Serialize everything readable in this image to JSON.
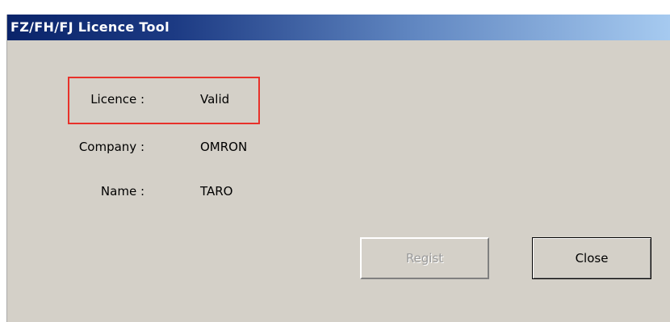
{
  "window": {
    "title": "FZ/FH/FJ Licence Tool"
  },
  "fields": {
    "licence": {
      "label": "Licence :",
      "value": "Valid"
    },
    "company": {
      "label": "Company :",
      "value": "OMRON"
    },
    "name": {
      "label": "Name :",
      "value": "TARO"
    }
  },
  "buttons": {
    "regist": {
      "label": "Regist",
      "enabled": false
    },
    "close": {
      "label": "Close",
      "enabled": true
    }
  },
  "colors": {
    "highlight": "#e8312a",
    "dialog_background": "#d4d0c8",
    "titlebar_start": "#0a246a",
    "titlebar_end": "#a6caf0"
  }
}
